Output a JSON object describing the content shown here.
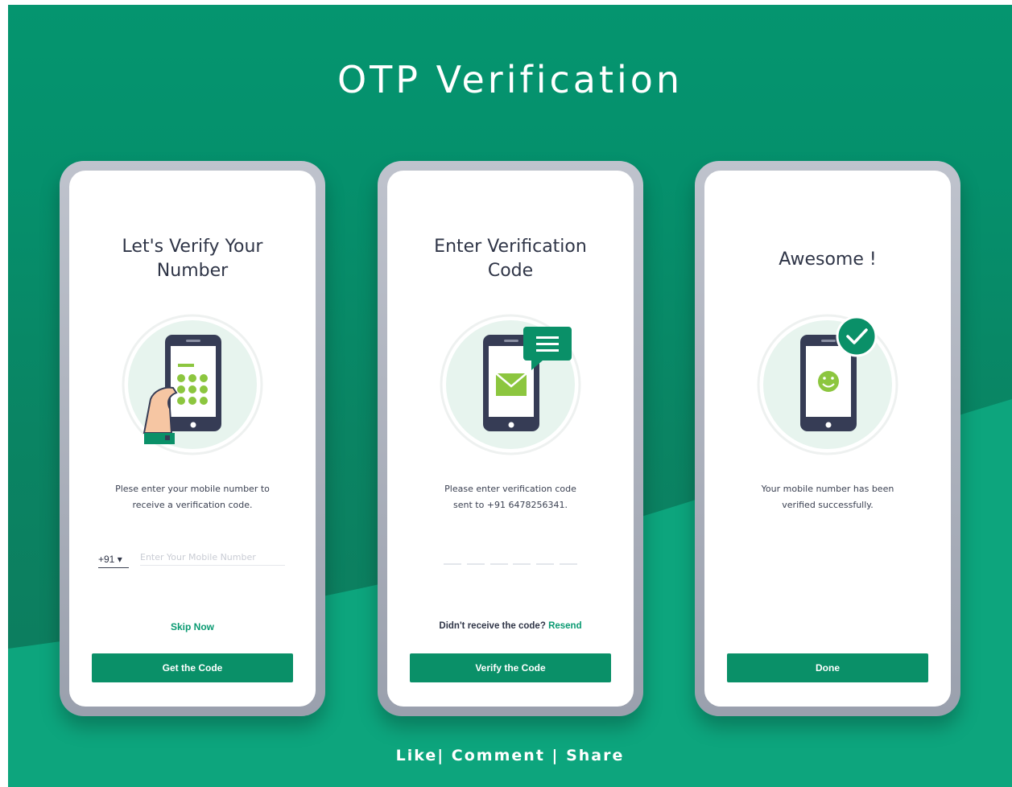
{
  "page": {
    "title": "OTP Verification",
    "footer": "Like| Comment | Share"
  },
  "colors": {
    "accent": "#0a9068",
    "background": "#05956f",
    "text_dark": "#2f3547",
    "lime": "#8cc63f"
  },
  "screens": [
    {
      "title_line1": "Let's Verify Your",
      "title_line2": "Number",
      "illustration": "hand-holding-phone-keypad",
      "desc_line1": "Plese enter your mobile number to",
      "desc_line2": "receive a verification code.",
      "country_code": "+91 ▾",
      "input_placeholder": "Enter Your Mobile Number",
      "input_value": "",
      "link_label": "Skip Now",
      "button_label": "Get the Code"
    },
    {
      "title_line1": "Enter Verification",
      "title_line2": "Code",
      "illustration": "phone-with-message-envelope",
      "desc_line1": "Please enter verification code",
      "desc_line2": "sent to +91 6478256341.",
      "resend_prompt": "Didn't receive the code?",
      "resend_label": "Resend",
      "button_label": "Verify the Code"
    },
    {
      "title_line1": "Awesome !",
      "illustration": "phone-with-smiley-checkmark",
      "desc_line1": "Your mobile number has been",
      "desc_line2": "verified successfully.",
      "button_label": "Done"
    }
  ]
}
